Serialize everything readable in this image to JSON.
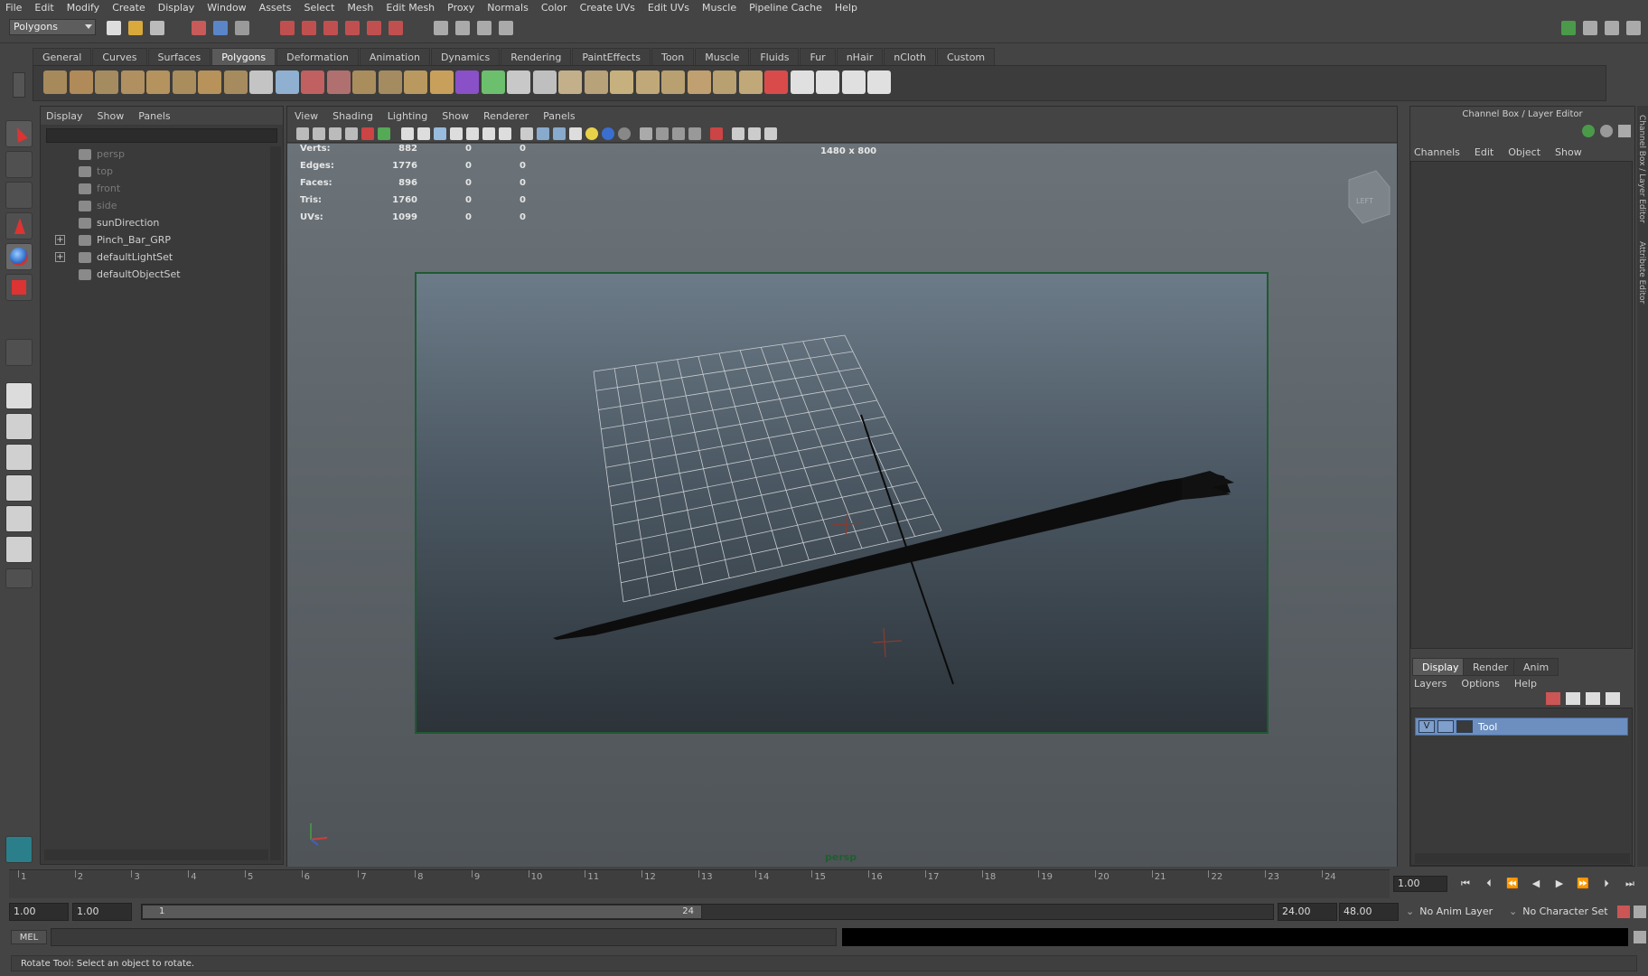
{
  "menubar": [
    "File",
    "Edit",
    "Modify",
    "Create",
    "Display",
    "Window",
    "Assets",
    "Select",
    "Mesh",
    "Edit Mesh",
    "Proxy",
    "Normals",
    "Color",
    "Create UVs",
    "Edit UVs",
    "Muscle",
    "Pipeline Cache",
    "Help"
  ],
  "mode_selector": "Polygons",
  "shelf_tabs": [
    "General",
    "Curves",
    "Surfaces",
    "Polygons",
    "Deformation",
    "Animation",
    "Dynamics",
    "Rendering",
    "PaintEffects",
    "Toon",
    "Muscle",
    "Fluids",
    "Fur",
    "nHair",
    "nCloth",
    "Custom"
  ],
  "shelf_active": "Polygons",
  "outliner": {
    "menu": [
      "Display",
      "Show",
      "Panels"
    ],
    "items": [
      {
        "label": "persp",
        "dim": true
      },
      {
        "label": "top",
        "dim": true
      },
      {
        "label": "front",
        "dim": true
      },
      {
        "label": "side",
        "dim": true
      },
      {
        "label": "sunDirection",
        "dim": false
      },
      {
        "label": "Pinch_Bar_GRP",
        "dim": false,
        "expand": true
      },
      {
        "label": "defaultLightSet",
        "dim": false,
        "expand": true
      },
      {
        "label": "defaultObjectSet",
        "dim": false
      }
    ]
  },
  "viewport": {
    "menu": [
      "View",
      "Shading",
      "Lighting",
      "Show",
      "Renderer",
      "Panels"
    ],
    "hud": [
      {
        "label": "Verts:",
        "a": "882",
        "b": "0",
        "c": "0"
      },
      {
        "label": "Edges:",
        "a": "1776",
        "b": "0",
        "c": "0"
      },
      {
        "label": "Faces:",
        "a": "896",
        "b": "0",
        "c": "0"
      },
      {
        "label": "Tris:",
        "a": "1760",
        "b": "0",
        "c": "0"
      },
      {
        "label": "UVs:",
        "a": "1099",
        "b": "0",
        "c": "0"
      }
    ],
    "resolution": "1480 x 800",
    "camera": "persp",
    "viewcube_label": "LEFT"
  },
  "channelbox": {
    "title": "Channel Box / Layer Editor",
    "menu": [
      "Channels",
      "Edit",
      "Object",
      "Show"
    ],
    "layer_tabs": [
      "Display",
      "Render",
      "Anim"
    ],
    "layer_menu": [
      "Layers",
      "Options",
      "Help"
    ],
    "layer": {
      "visible": "V",
      "name": "Tool"
    },
    "side_labels": [
      "Channel Box / Layer Editor",
      "Attribute Editor"
    ]
  },
  "timeline": {
    "ticks": [
      "1",
      "2",
      "3",
      "4",
      "5",
      "6",
      "7",
      "8",
      "9",
      "10",
      "11",
      "12",
      "13",
      "14",
      "15",
      "16",
      "17",
      "18",
      "19",
      "20",
      "21",
      "22",
      "23",
      "24"
    ],
    "current_frame": "1.00"
  },
  "range": {
    "start": "1.00",
    "anim_start": "1.00",
    "handle_start": "1",
    "handle_end": "24",
    "anim_end": "24.00",
    "end": "48.00",
    "anim_layer": "No Anim Layer",
    "character_set": "No Character Set"
  },
  "cmd": {
    "label": "MEL"
  },
  "help_line": "Rotate Tool: Select an object to rotate.",
  "colors": {
    "accent_green": "#1f5a32",
    "layer_blue": "#6c8fbf"
  }
}
